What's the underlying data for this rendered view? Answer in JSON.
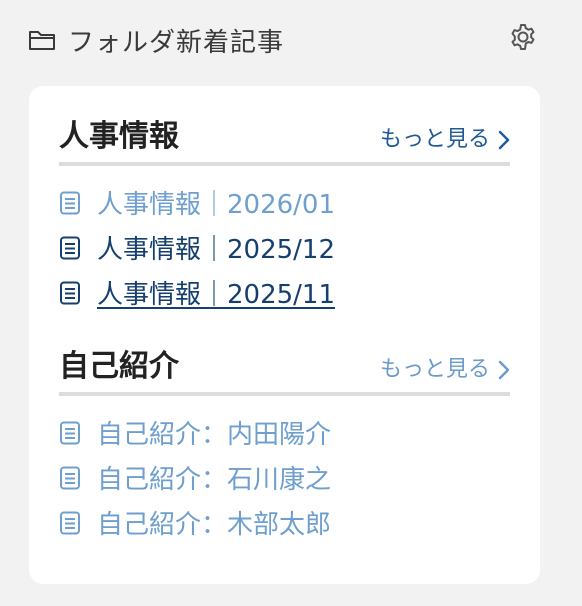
{
  "header": {
    "title": "フォルダ新着記事",
    "folder_icon": "folder-icon",
    "settings_icon": "gear-icon"
  },
  "sections": [
    {
      "title": "人事情報",
      "more_label": "もっと見る",
      "items": [
        {
          "label": "人事情報｜2026/01",
          "state": "visited"
        },
        {
          "label": "人事情報｜2025/12",
          "state": "default"
        },
        {
          "label": "人事情報｜2025/11",
          "state": "hover"
        }
      ]
    },
    {
      "title": "自己紹介",
      "more_label": "もっと見る",
      "items": [
        {
          "label": "自己紹介：内田陽介",
          "state": "visited"
        },
        {
          "label": "自己紹介：石川康之",
          "state": "visited"
        },
        {
          "label": "自己紹介：木部太郎",
          "state": "visited"
        }
      ]
    }
  ],
  "colors": {
    "background": "#f2f2f2",
    "card": "#ffffff",
    "link_dark": "#153f6e",
    "link_light": "#6e9fcf",
    "divider": "#dcdcdc"
  }
}
